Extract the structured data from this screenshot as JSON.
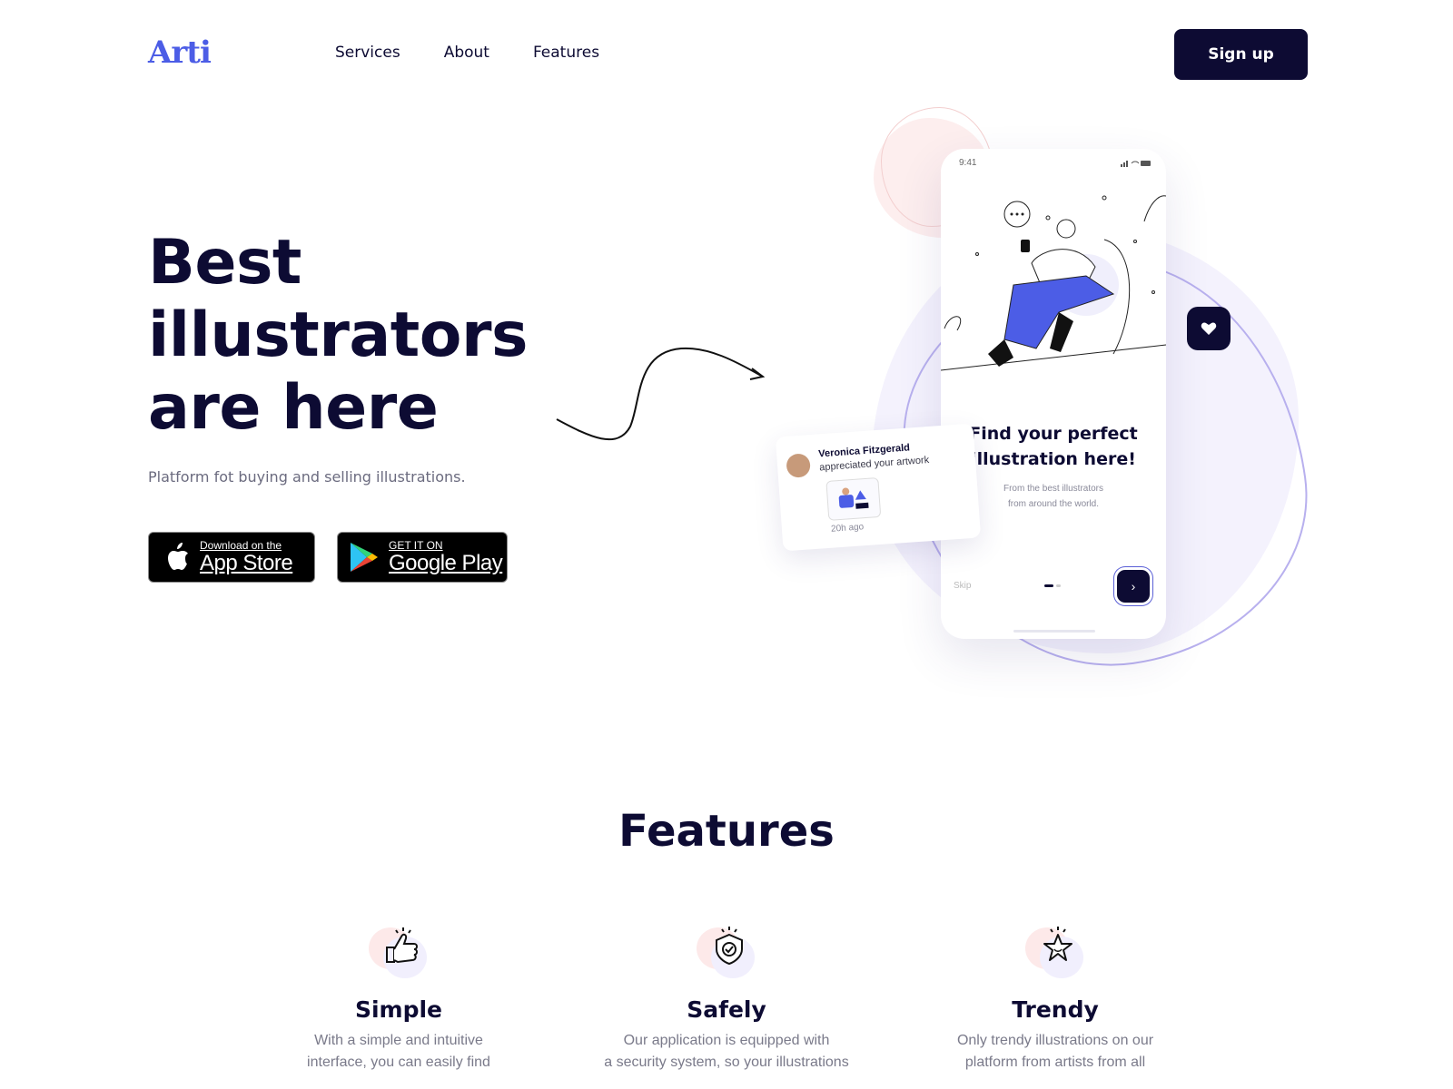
{
  "header": {
    "logo": "Arti",
    "nav": [
      "Services",
      "About",
      "Features"
    ],
    "signup": "Sign up"
  },
  "hero": {
    "title_lines": [
      "Best",
      "illustrators",
      "are here"
    ],
    "subtitle": "Platform fot buying and selling illustrations.",
    "app_store": {
      "small": "Download on the",
      "big": "App Store"
    },
    "google_play": {
      "small": "GET IT ON",
      "big": "Google Play"
    }
  },
  "phone": {
    "time": "9:41",
    "title_lines": [
      "Find your perfect",
      "illustration here!"
    ],
    "sub_lines": [
      "From the best illustrators",
      "from around the world."
    ],
    "skip": "Skip",
    "next": "›"
  },
  "notification": {
    "name": "Veronica Fitzgerald",
    "action": "appreciated your artwork",
    "ago": "20h ago"
  },
  "features": {
    "title": "Features",
    "items": [
      {
        "title": "Simple",
        "lines": [
          "With a simple and intuitive",
          "interface, you can easily find"
        ],
        "icon": "thumbs-up-icon"
      },
      {
        "title": "Safely",
        "lines": [
          "Our application is equipped with",
          "a security system, so your illustrations"
        ],
        "icon": "shield-check-icon"
      },
      {
        "title": "Trendy",
        "lines": [
          "Only trendy illustrations on our",
          "platform from artists from all"
        ],
        "icon": "star-icon"
      }
    ]
  },
  "colors": {
    "primary": "#0d0b33",
    "accent": "#4c5de6"
  }
}
